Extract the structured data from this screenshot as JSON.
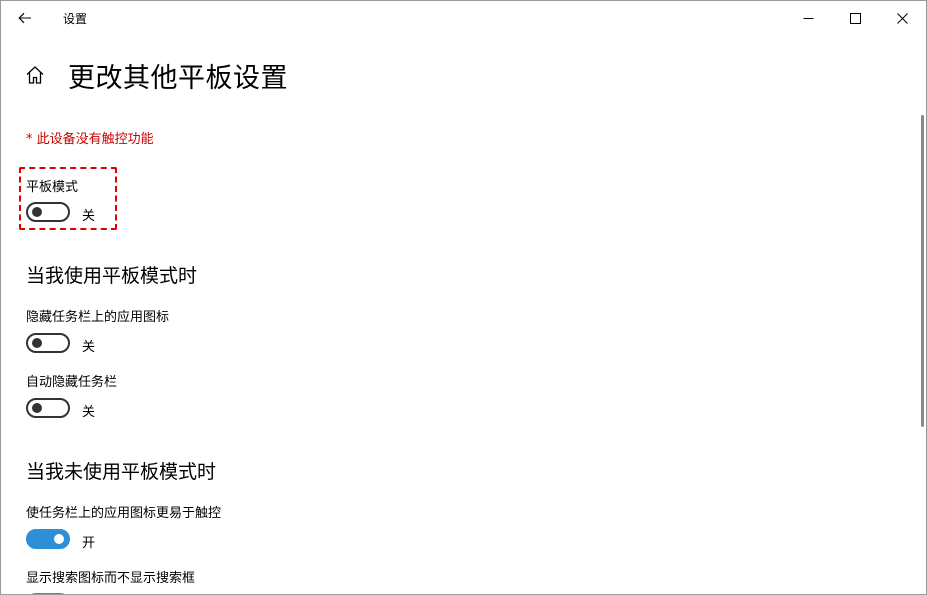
{
  "window": {
    "app_title": "设置"
  },
  "header": {
    "title": "更改其他平板设置"
  },
  "warning": "* 此设备没有触控功能",
  "tablet_mode": {
    "label": "平板模式",
    "state_text": "关",
    "on": false
  },
  "section_using": {
    "heading": "当我使用平板模式时",
    "settings": [
      {
        "label": "隐藏任务栏上的应用图标",
        "state_text": "关",
        "on": false
      },
      {
        "label": "自动隐藏任务栏",
        "state_text": "关",
        "on": false
      }
    ]
  },
  "section_not_using": {
    "heading": "当我未使用平板模式时",
    "settings": [
      {
        "label": "使任务栏上的应用图标更易于触控",
        "state_text": "开",
        "on": true
      },
      {
        "label": "显示搜索图标而不显示搜索框",
        "state_text": "",
        "on": true
      }
    ]
  },
  "icons": {
    "back": "back-arrow-icon",
    "home": "home-icon",
    "minimize": "minimize-icon",
    "maximize": "maximize-icon",
    "close": "close-icon"
  },
  "colors": {
    "accent": "#2d8fd5",
    "warning": "#c50500",
    "highlight": "#e00000"
  }
}
